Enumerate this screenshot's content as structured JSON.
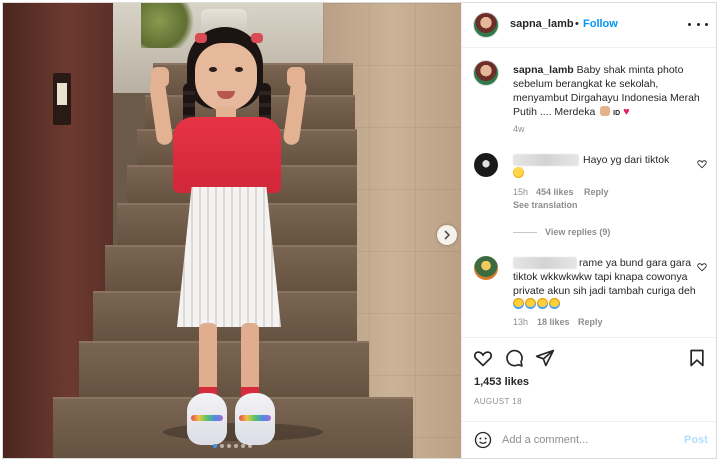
{
  "post": {
    "author": "sapna_lamb",
    "follow_label": "Follow",
    "bullet": "•",
    "caption": "Baby shak minta photo sebelum berangkat ke sekolah, menyambut Dirgahayu Indonesia Merah Putih .... Merdeka",
    "caption_suffix": "ID",
    "age": "4w"
  },
  "comments": [
    {
      "text": "Hayo yg dari tiktok",
      "time": "15h",
      "likes": "454 likes",
      "reply_label": "Reply",
      "see_translation": "See translation",
      "view_replies": "View replies (9)"
    },
    {
      "text": "rame ya bund gara gara tiktok wkkwkwkw tapi knapa cowonya private akun sih jadi tambah curiga deh",
      "time": "13h",
      "likes": "18 likes",
      "reply_label": "Reply"
    }
  ],
  "stats": {
    "likes": "1,453 likes",
    "date": "AUGUST 18"
  },
  "comment_box": {
    "placeholder": "Add a comment...",
    "post_label": "Post"
  },
  "icons": {
    "more": "more-horizontal-icon",
    "like": "heart-icon",
    "comment": "comment-icon",
    "share": "share-icon",
    "save": "bookmark-icon",
    "emoji": "emoji-icon",
    "next": "chevron-right-icon"
  },
  "colors": {
    "accent": "#0095f6",
    "post_disabled": "#b2dffc",
    "muted": "#8e8e8e",
    "text": "#262626"
  },
  "carousel": {
    "total": 6,
    "active": 1
  }
}
